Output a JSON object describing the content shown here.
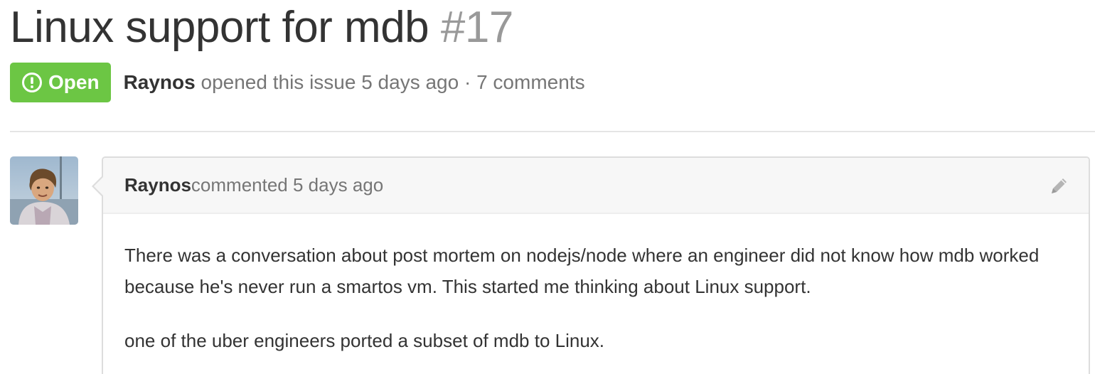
{
  "issue": {
    "title": "Linux support for mdb",
    "number": "#17",
    "state_label": "Open",
    "state_icon": "issue-opened-icon",
    "state_color": "#6cc644",
    "author": "Raynos",
    "opened_text": " opened this issue 5 days ago · 7 comments"
  },
  "comment": {
    "author": "Raynos",
    "meta_text": " commented 5 days ago",
    "edit_icon": "pencil-icon",
    "paragraphs": [
      "There was a conversation about post mortem on nodejs/node where an engineer did not know how mdb worked because he's never run a smartos vm. This started me thinking about Linux support.",
      "one of the uber engineers ported a subset of mdb to Linux."
    ]
  },
  "colors": {
    "open_green": "#6cc644",
    "muted_text": "#767676",
    "number_gray": "#999999",
    "header_bg": "#f7f7f7",
    "border": "#dddddd"
  }
}
